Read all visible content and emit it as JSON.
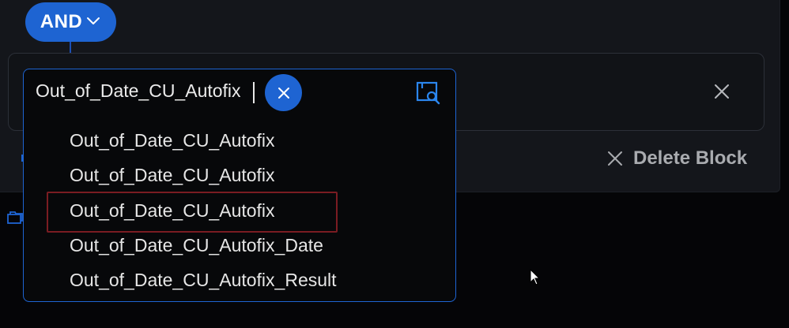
{
  "logic_operator": {
    "label": "AND",
    "chevron_icon": "chevron-down-icon"
  },
  "search": {
    "value": "Out_of_Date_CU_Autofix",
    "clear_icon": "close-icon",
    "lookup_icon": "lookup-search-icon"
  },
  "options": [
    {
      "label": "Out_of_Date_CU_Autofix"
    },
    {
      "label": "Out_of_Date_CU_Autofix"
    },
    {
      "label": "Out_of_Date_CU_Autofix",
      "highlighted": true
    },
    {
      "label": "Out_of_Date_CU_Autofix_Date"
    },
    {
      "label": "Out_of_Date_CU_Autofix_Result"
    }
  ],
  "block": {
    "remove_icon": "close-icon",
    "delete_label": "Delete Block"
  },
  "colors": {
    "accent": "#1e64d2",
    "highlight_border": "#7a1c22",
    "background": "#050507",
    "panel": "#14161b"
  }
}
